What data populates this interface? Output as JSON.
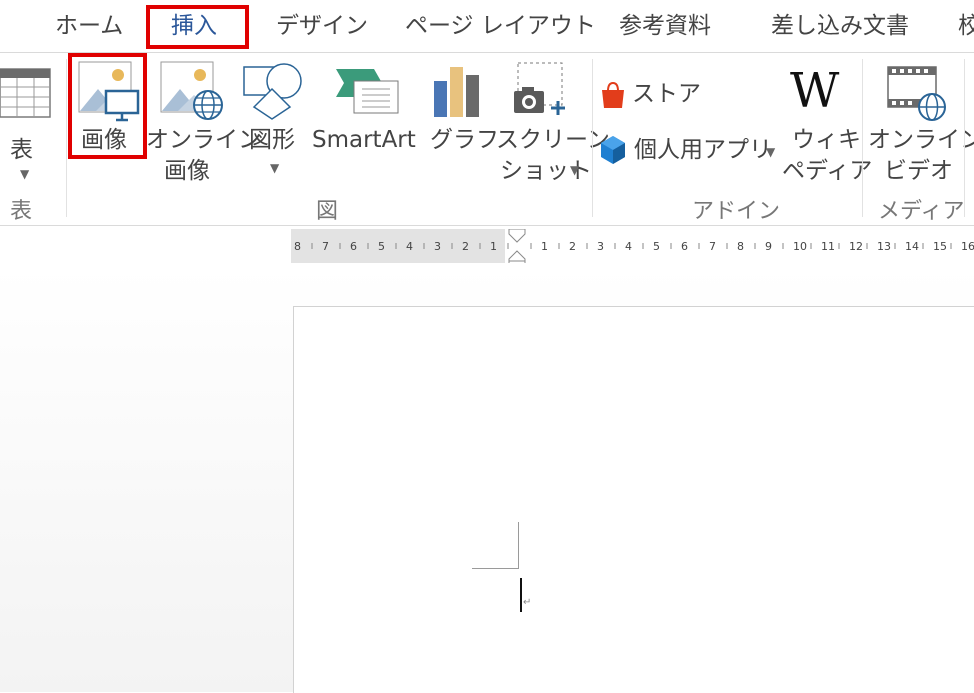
{
  "tabs": [
    "ホーム",
    "挿入",
    "デザイン",
    "ページ レイアウト",
    "参考資料",
    "差し込み文書",
    "校"
  ],
  "ribbon": {
    "table_label": "表",
    "picture_label": "画像",
    "online_picture_label": [
      "オンライン",
      "画像"
    ],
    "shapes_label": "図形",
    "smartart_label": "SmartArt",
    "chart_label": "グラフ",
    "screenshot_label": [
      "スクリーン",
      "ショット"
    ],
    "store_label": "ストア",
    "my_addins_label": "個人用アプリ",
    "wiki_label": [
      "ウィキ",
      "ペディア"
    ],
    "online_video_label": [
      "オンライン",
      "ビデオ"
    ],
    "groups": [
      "表",
      "図",
      "アドイン",
      "メディア"
    ]
  },
  "ruler": {
    "left_numbers": [
      "8",
      "7",
      "6",
      "5",
      "4",
      "3",
      "2",
      "1"
    ],
    "right_numbers": [
      "1",
      "2",
      "3",
      "4",
      "5",
      "6",
      "7",
      "8",
      "9",
      "10",
      "11",
      "12",
      "13",
      "14",
      "15",
      "16"
    ]
  },
  "colors": {
    "highlight": "#e00000",
    "store_red": "#e23d1b",
    "addin_blue": "#1f7fd1"
  }
}
